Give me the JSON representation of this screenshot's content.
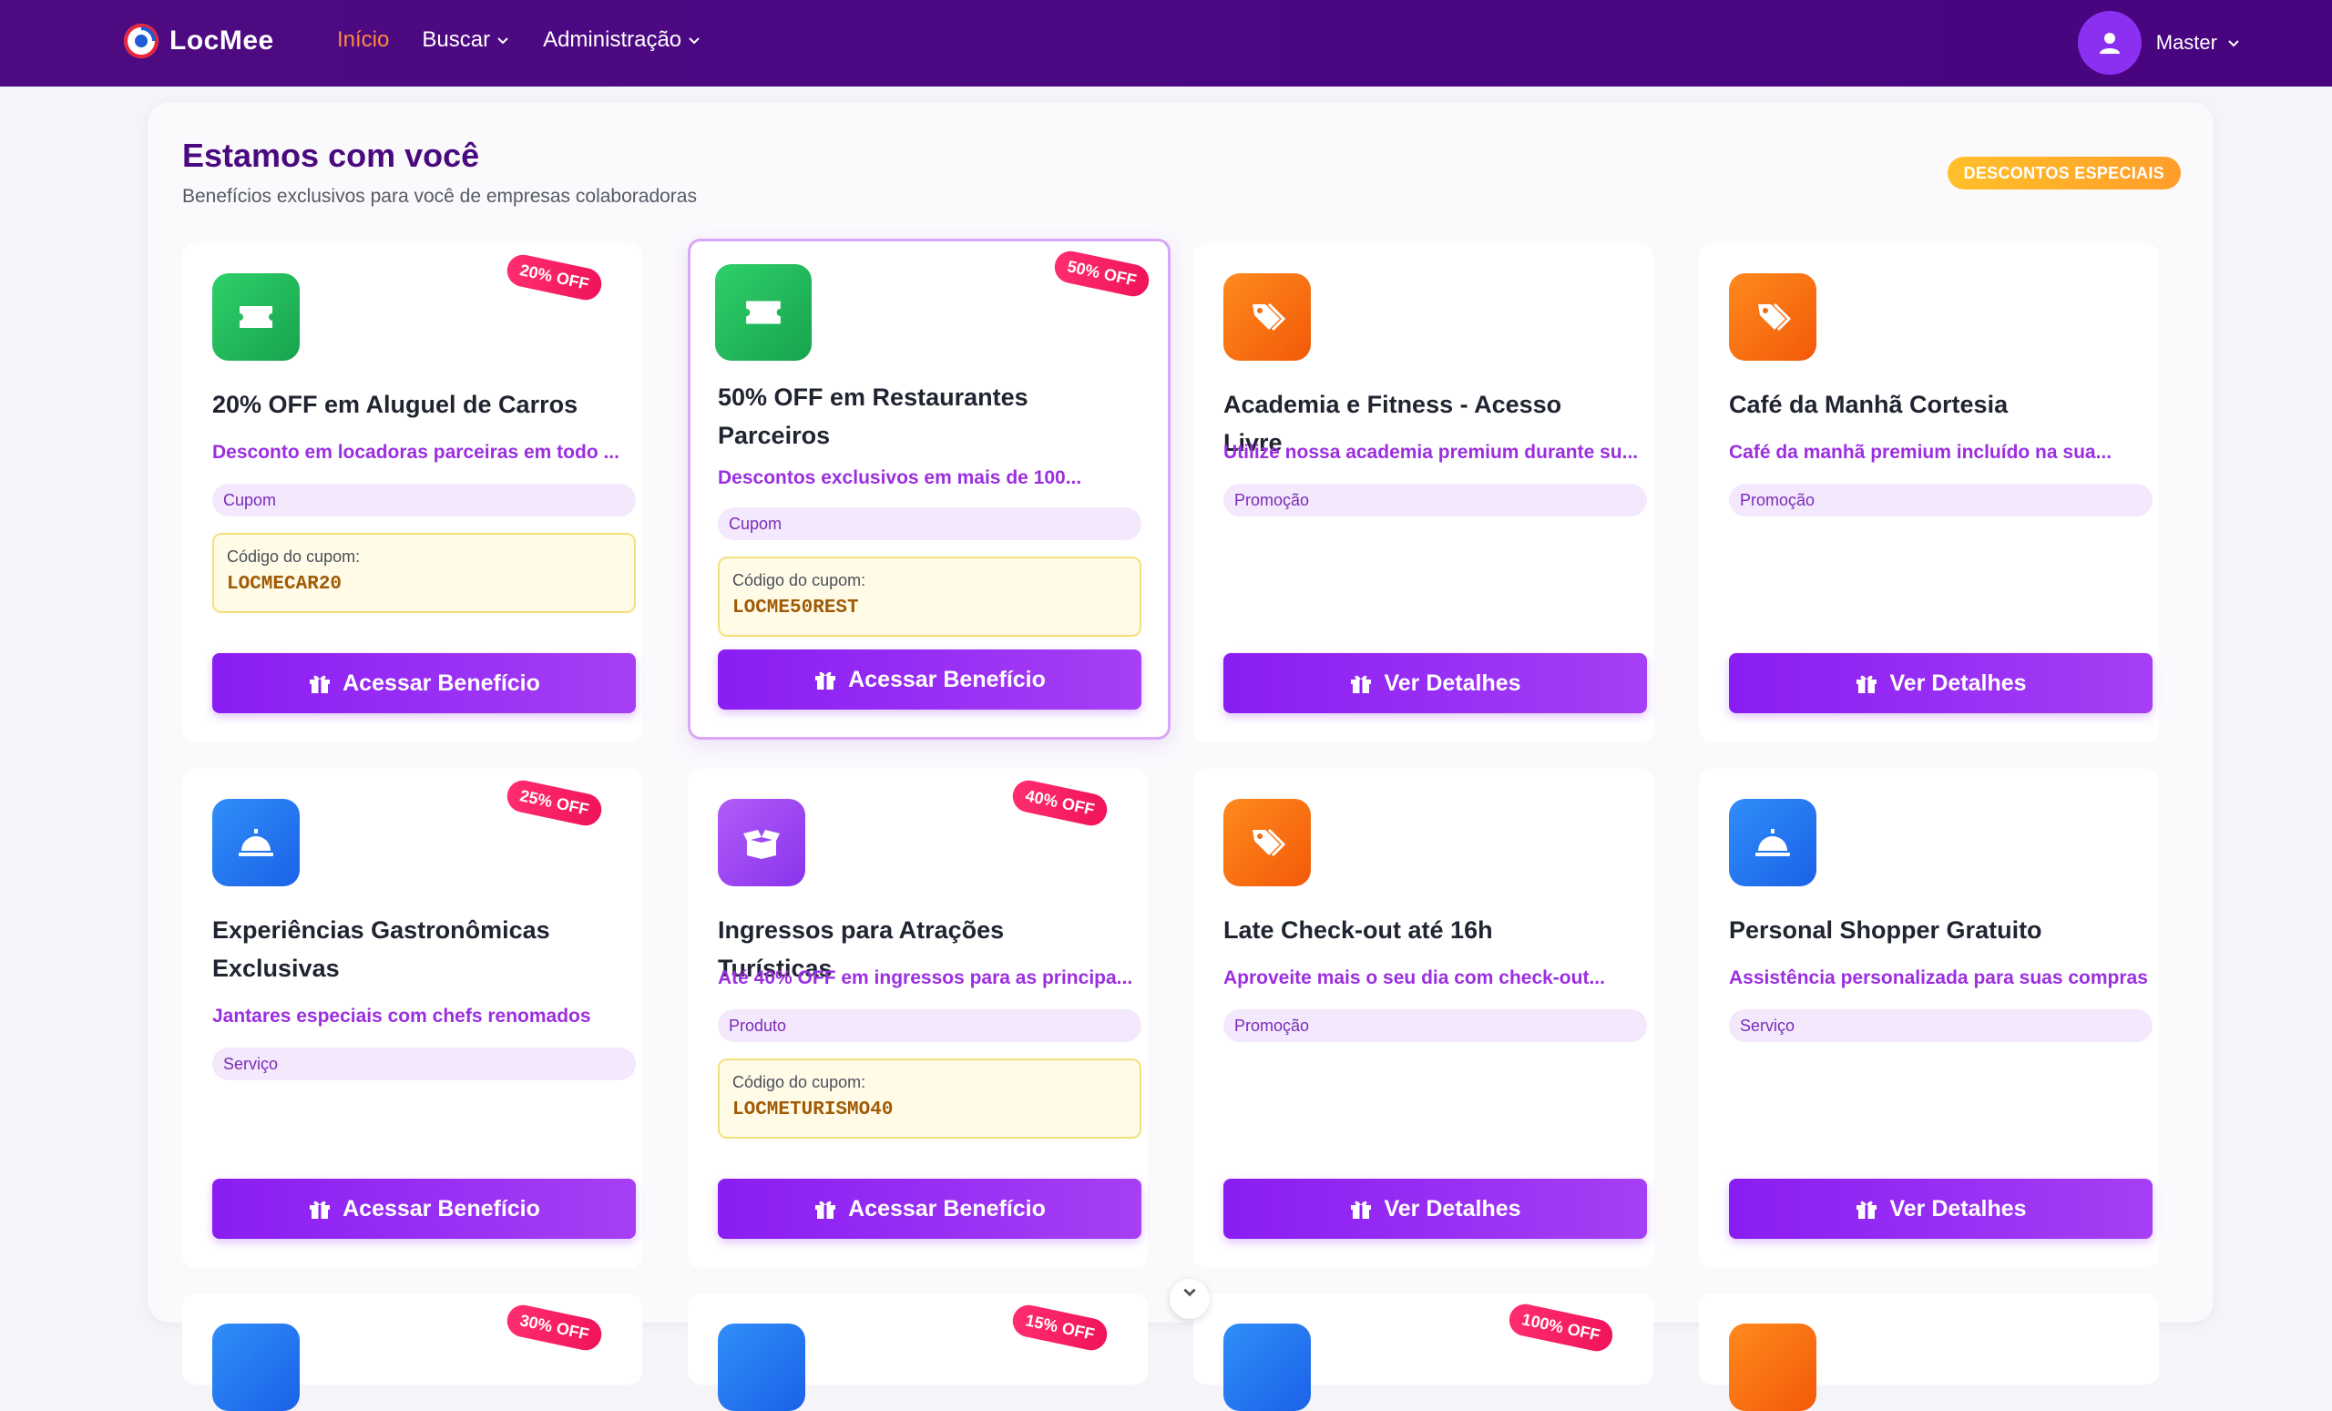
{
  "brand": {
    "name": "LocMee"
  },
  "nav": {
    "items": [
      {
        "label": "Início",
        "active": true
      },
      {
        "label": "Buscar",
        "dropdown": true
      },
      {
        "label": "Administração",
        "dropdown": true
      }
    ]
  },
  "user": {
    "name": "Master"
  },
  "panel": {
    "title": "Estamos com você",
    "subtitle": "Benefícios exclusivos para você de empresas colaboradoras",
    "badge": "DESCONTOS ESPECIAIS"
  },
  "cards": [
    {
      "icon": "ticket-icon",
      "icon_color": "green",
      "off": "20% OFF",
      "title": "20% OFF em Aluguel de Carros",
      "desc": "Desconto em locadoras parceiras em todo ...",
      "tag": "Cupom",
      "coupon_label": "Código do cupom:",
      "coupon_code": "LOCMECAR20",
      "button": "Acessar Benefício"
    },
    {
      "icon": "ticket-icon",
      "icon_color": "green",
      "off": "50% OFF",
      "title": "50% OFF em Restaurantes Parceiros",
      "desc": "Descontos exclusivos em mais de 100...",
      "tag": "Cupom",
      "coupon_label": "Código do cupom:",
      "coupon_code": "LOCME50REST",
      "button": "Acessar Benefício"
    },
    {
      "icon": "tags-icon",
      "icon_color": "orange",
      "off": "",
      "title": "Academia e Fitness - Acesso Livre",
      "desc": "Utilize nossa academia premium durante su...",
      "tag": "Promoção",
      "coupon_label": "",
      "coupon_code": "",
      "button": "Ver Detalhes"
    },
    {
      "icon": "tags-icon",
      "icon_color": "orange",
      "off": "",
      "title": "Café da Manhã Cortesia",
      "desc": "Café da manhã premium incluído na sua...",
      "tag": "Promoção",
      "coupon_label": "",
      "coupon_code": "",
      "button": "Ver Detalhes"
    },
    {
      "icon": "concierge-bell-icon",
      "icon_color": "blue",
      "off": "25% OFF",
      "title": "Experiências Gastronômicas Exclusivas",
      "desc": "Jantares especiais com chefs renomados",
      "tag": "Serviço",
      "coupon_label": "",
      "coupon_code": "",
      "button": "Acessar Benefício"
    },
    {
      "icon": "box-open-icon",
      "icon_color": "purple",
      "off": "40% OFF",
      "title": "Ingressos para Atrações Turísticas",
      "desc": "Até 40% OFF em ingressos para as principa...",
      "tag": "Produto",
      "coupon_label": "Código do cupom:",
      "coupon_code": "LOCMETURISMO40",
      "button": "Acessar Benefício"
    },
    {
      "icon": "tags-icon",
      "icon_color": "orange",
      "off": "",
      "title": "Late Check-out até 16h",
      "desc": "Aproveite mais o seu dia com check-out...",
      "tag": "Promoção",
      "coupon_label": "",
      "coupon_code": "",
      "button": "Ver Detalhes"
    },
    {
      "icon": "concierge-bell-icon",
      "icon_color": "blue",
      "off": "",
      "title": "Personal Shopper Gratuito",
      "desc": "Assistência personalizada para suas compras",
      "tag": "Serviço",
      "coupon_label": "",
      "coupon_code": "",
      "button": "Ver Detalhes"
    }
  ],
  "next_row": [
    {
      "icon_color": "blue",
      "off": "30% OFF"
    },
    {
      "icon_color": "blue",
      "off": "15% OFF"
    },
    {
      "icon_color": "blue",
      "off": "100% OFF"
    },
    {
      "icon_color": "orange",
      "off": ""
    }
  ],
  "colors": {
    "navbar": "#4a0784",
    "accent": "#8a1df2",
    "active_nav": "#ff8a3d",
    "title": "#4a0a7e"
  }
}
